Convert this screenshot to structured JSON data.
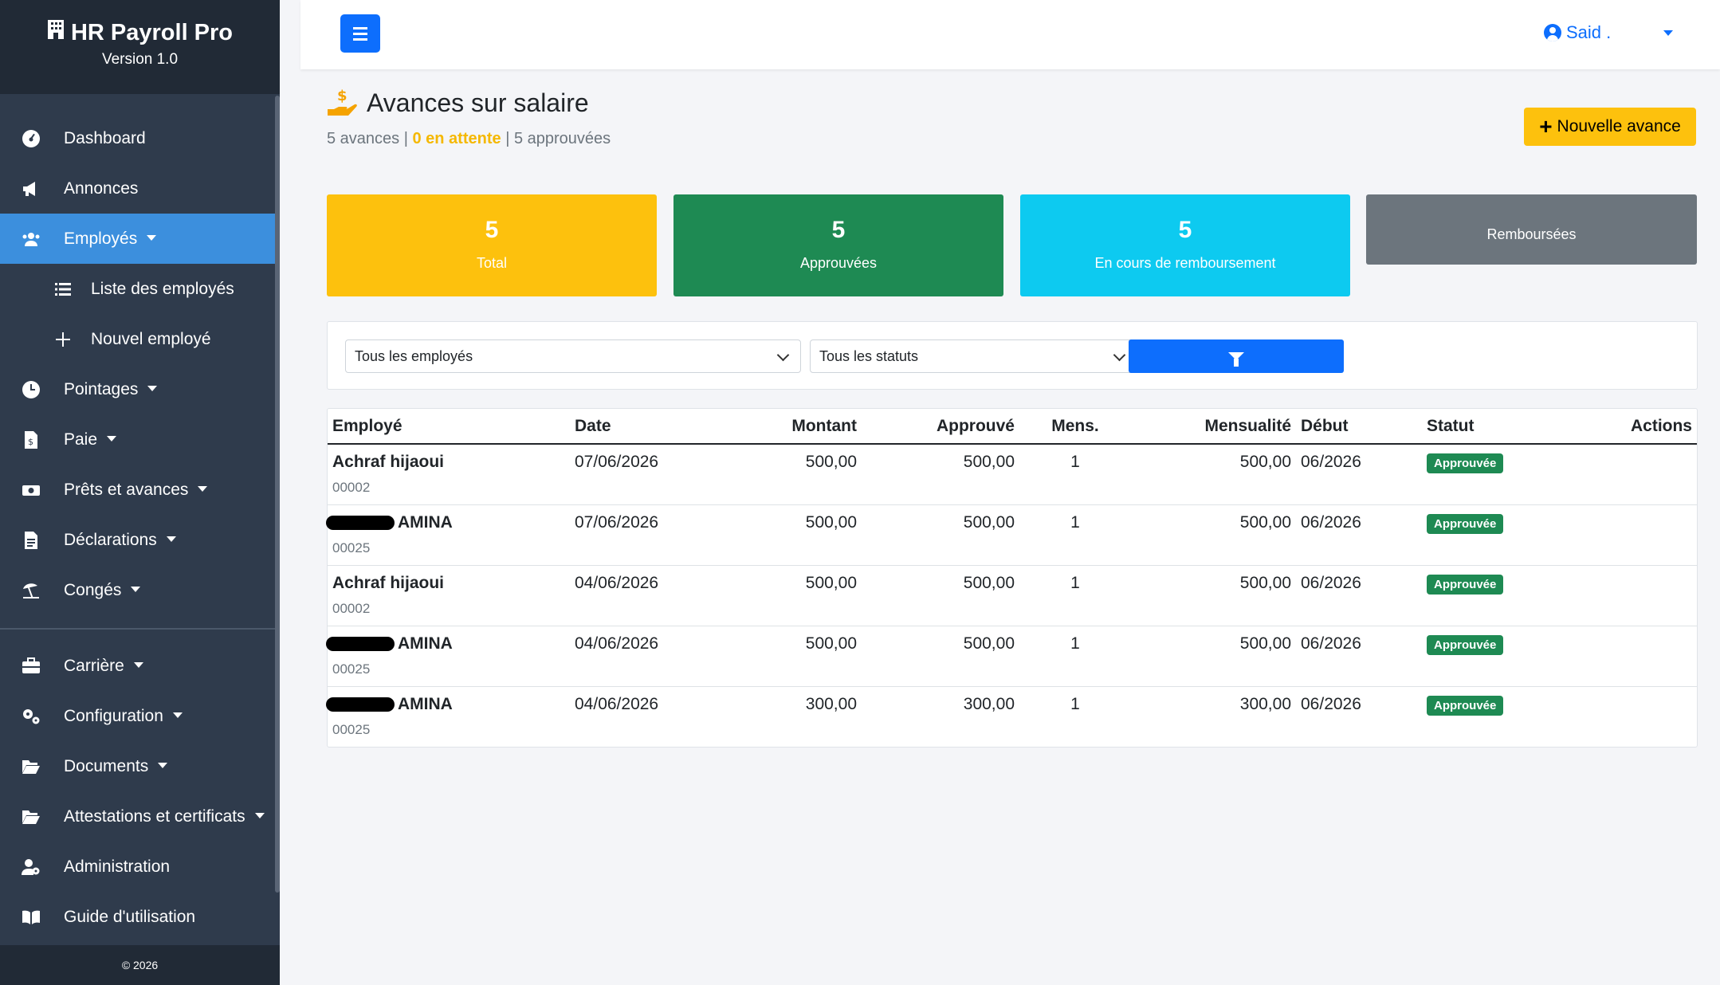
{
  "app": {
    "title": "HR Payroll Pro",
    "version": "Version 1.0",
    "footer": "© 2026"
  },
  "sidebar": {
    "items": [
      {
        "label": "Dashboard",
        "icon": "dashboard-icon"
      },
      {
        "label": "Annonces",
        "icon": "megaphone-icon"
      },
      {
        "label": "Employés",
        "icon": "users-icon",
        "active": true
      },
      {
        "label": "Liste des employés",
        "icon": "list-icon"
      },
      {
        "label": "Nouvel employé",
        "icon": "plus-icon"
      },
      {
        "label": "Pointages",
        "icon": "clock-icon"
      },
      {
        "label": "Paie",
        "icon": "invoice-dollar-icon"
      },
      {
        "label": "Prêts et avances",
        "icon": "money-bill-icon"
      },
      {
        "label": "Déclarations",
        "icon": "file-text-icon"
      },
      {
        "label": "Congés",
        "icon": "umbrella-beach-icon"
      },
      {
        "label": "Carrière",
        "icon": "briefcase-icon"
      },
      {
        "label": "Configuration",
        "icon": "gears-icon"
      },
      {
        "label": "Documents",
        "icon": "folder-open-icon"
      },
      {
        "label": "Attestations et certificats",
        "icon": "folder-open-icon"
      },
      {
        "label": "Administration",
        "icon": "user-gear-icon"
      },
      {
        "label": "Guide d'utilisation",
        "icon": "book-icon"
      }
    ]
  },
  "topbar": {
    "user_name": "Said ."
  },
  "page": {
    "title": "Avances sur salaire",
    "summary_count": "5 avances",
    "summary_sep1": " | ",
    "summary_pending": "0 en attente",
    "summary_sep2": " | ",
    "summary_approved": "5 approuvées",
    "new_button": "Nouvelle avance"
  },
  "cards": [
    {
      "value": "5",
      "label": "Total",
      "color": "#fdc10d"
    },
    {
      "value": "5",
      "label": "Approuvées",
      "color": "#1e8a53"
    },
    {
      "value": "5",
      "label": "En cours de remboursement",
      "color": "#0dcaf0"
    },
    {
      "value": "",
      "label": "Remboursées",
      "color": "#6c757d"
    }
  ],
  "filters": {
    "employee_select": "Tous les employés",
    "status_select": "Tous les statuts"
  },
  "table": {
    "headers": [
      "Employé",
      "Date",
      "Montant",
      "Approuvé",
      "Mens.",
      "Mensualité",
      "Début",
      "Statut",
      "Actions"
    ],
    "rows": [
      {
        "name": "Achraf hijaoui",
        "code": "00002",
        "date": "07/06/2026",
        "montant": "500,00",
        "approuve": "500,00",
        "mens": "1",
        "mensualite": "500,00",
        "debut": "06/2026",
        "statut": "Approuvée"
      },
      {
        "name": "AMINA",
        "code": "00025",
        "date": "07/06/2026",
        "montant": "500,00",
        "approuve": "500,00",
        "mens": "1",
        "mensualite": "500,00",
        "debut": "06/2026",
        "statut": "Approuvée"
      },
      {
        "name": "Achraf hijaoui",
        "code": "00002",
        "date": "04/06/2026",
        "montant": "500,00",
        "approuve": "500,00",
        "mens": "1",
        "mensualite": "500,00",
        "debut": "06/2026",
        "statut": "Approuvée"
      },
      {
        "name": "AMINA",
        "code": "00025",
        "date": "04/06/2026",
        "montant": "500,00",
        "approuve": "500,00",
        "mens": "1",
        "mensualite": "500,00",
        "debut": "06/2026",
        "statut": "Approuvée"
      },
      {
        "name": "AMINA",
        "code": "00025",
        "date": "04/06/2026",
        "montant": "300,00",
        "approuve": "300,00",
        "mens": "1",
        "mensualite": "300,00",
        "debut": "06/2026",
        "statut": "Approuvée"
      }
    ]
  }
}
